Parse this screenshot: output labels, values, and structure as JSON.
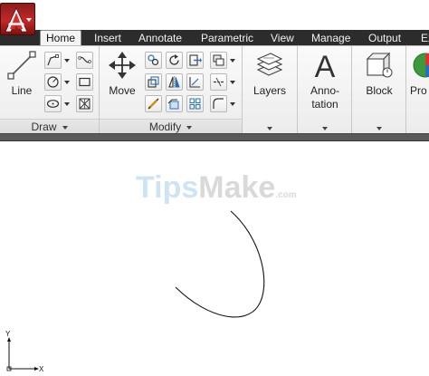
{
  "app": {
    "logo_letter": "A"
  },
  "tabs": [
    {
      "label": "Home",
      "active": true
    },
    {
      "label": "Insert"
    },
    {
      "label": "Annotate"
    },
    {
      "label": "Parametric"
    },
    {
      "label": "View"
    },
    {
      "label": "Manage"
    },
    {
      "label": "Output"
    },
    {
      "label": "Ex"
    }
  ],
  "ribbon": {
    "draw": {
      "title": "Draw",
      "line_label": "Line"
    },
    "modify": {
      "title": "Modify",
      "move_label": "Move"
    },
    "layers": {
      "label": "Layers"
    },
    "annotation": {
      "label_line1": "Anno-",
      "label_line2": "tation"
    },
    "block": {
      "label": "Block"
    },
    "properties": {
      "label": "Pro"
    }
  },
  "canvas": {
    "watermark_part1": "Tips",
    "watermark_part2": "Make",
    "watermark_part3": ".com",
    "ucs_y": "Y",
    "ucs_x": "X"
  },
  "colors": {
    "app_button": "#c62828",
    "tab_bar": "#2c2c2c",
    "ribbon_bg": "#f2f2f2",
    "icon_blue": "#2a6fb5",
    "icon_orange": "#d98a16",
    "watermark_blue": "#cfe4f3"
  }
}
